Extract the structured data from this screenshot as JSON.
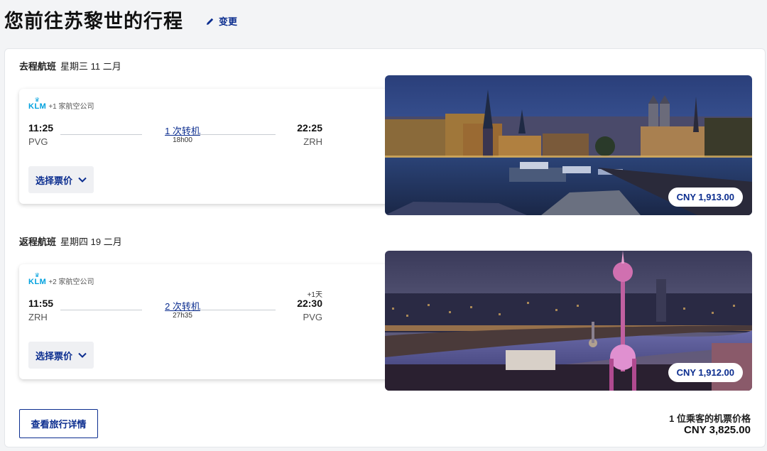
{
  "header": {
    "title": "您前往苏黎世的行程",
    "change_label": "变更"
  },
  "outbound": {
    "label": "去程航班",
    "date": "星期三 11 二月",
    "airline_logo": "KLM",
    "airline_extra": "+1 家航空公司",
    "dep_time": "11:25",
    "dep_code": "PVG",
    "stops": "1 次转机",
    "duration": "18h00",
    "arr_time": "22:25",
    "arr_code": "ZRH",
    "fare_label": "选择票价",
    "price": "CNY 1,913.00",
    "image_icon": "zurich-night-photo"
  },
  "inbound": {
    "label": "返程航班",
    "date": "星期四 19 二月",
    "airline_logo": "KLM",
    "airline_extra": "+2 家航空公司",
    "dep_time": "11:55",
    "dep_code": "ZRH",
    "stops": "2 次转机",
    "duration": "27h35",
    "plus_day": "+1天",
    "arr_time": "22:30",
    "arr_code": "PVG",
    "fare_label": "选择票价",
    "price": "CNY 1,912.00",
    "image_icon": "shanghai-night-photo"
  },
  "footer": {
    "details_label": "查看旅行详情",
    "total_label": "1 位乘客的机票价格",
    "total_price": "CNY 3,825.00"
  },
  "colors": {
    "accent": "#0b2d8f",
    "klm_blue": "#00a1de"
  }
}
